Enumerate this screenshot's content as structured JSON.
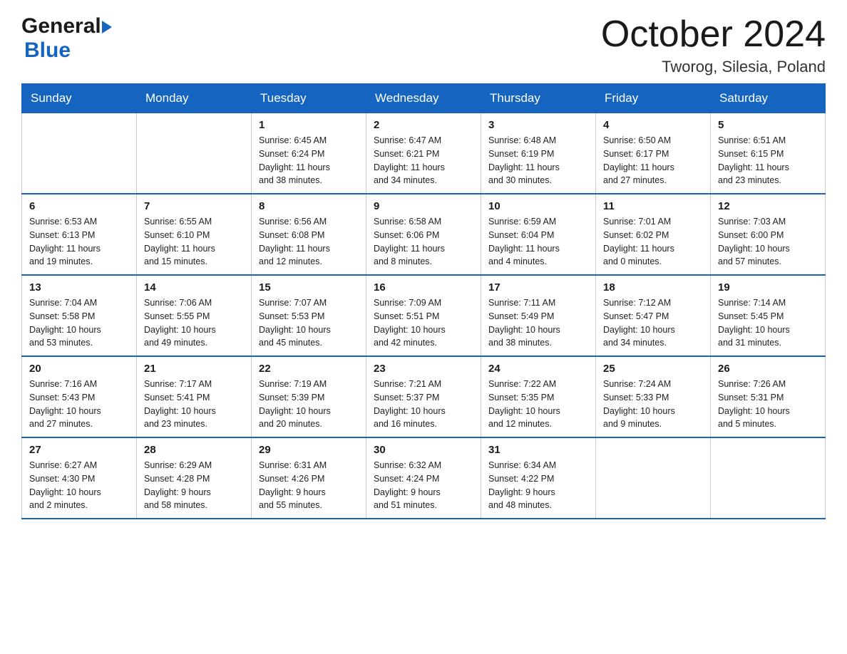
{
  "header": {
    "logo": {
      "line1": "General",
      "line2": "Blue"
    },
    "title": "October 2024",
    "location": "Tworog, Silesia, Poland"
  },
  "weekdays": [
    "Sunday",
    "Monday",
    "Tuesday",
    "Wednesday",
    "Thursday",
    "Friday",
    "Saturday"
  ],
  "weeks": [
    [
      {
        "day": "",
        "info": ""
      },
      {
        "day": "",
        "info": ""
      },
      {
        "day": "1",
        "info": "Sunrise: 6:45 AM\nSunset: 6:24 PM\nDaylight: 11 hours\nand 38 minutes."
      },
      {
        "day": "2",
        "info": "Sunrise: 6:47 AM\nSunset: 6:21 PM\nDaylight: 11 hours\nand 34 minutes."
      },
      {
        "day": "3",
        "info": "Sunrise: 6:48 AM\nSunset: 6:19 PM\nDaylight: 11 hours\nand 30 minutes."
      },
      {
        "day": "4",
        "info": "Sunrise: 6:50 AM\nSunset: 6:17 PM\nDaylight: 11 hours\nand 27 minutes."
      },
      {
        "day": "5",
        "info": "Sunrise: 6:51 AM\nSunset: 6:15 PM\nDaylight: 11 hours\nand 23 minutes."
      }
    ],
    [
      {
        "day": "6",
        "info": "Sunrise: 6:53 AM\nSunset: 6:13 PM\nDaylight: 11 hours\nand 19 minutes."
      },
      {
        "day": "7",
        "info": "Sunrise: 6:55 AM\nSunset: 6:10 PM\nDaylight: 11 hours\nand 15 minutes."
      },
      {
        "day": "8",
        "info": "Sunrise: 6:56 AM\nSunset: 6:08 PM\nDaylight: 11 hours\nand 12 minutes."
      },
      {
        "day": "9",
        "info": "Sunrise: 6:58 AM\nSunset: 6:06 PM\nDaylight: 11 hours\nand 8 minutes."
      },
      {
        "day": "10",
        "info": "Sunrise: 6:59 AM\nSunset: 6:04 PM\nDaylight: 11 hours\nand 4 minutes."
      },
      {
        "day": "11",
        "info": "Sunrise: 7:01 AM\nSunset: 6:02 PM\nDaylight: 11 hours\nand 0 minutes."
      },
      {
        "day": "12",
        "info": "Sunrise: 7:03 AM\nSunset: 6:00 PM\nDaylight: 10 hours\nand 57 minutes."
      }
    ],
    [
      {
        "day": "13",
        "info": "Sunrise: 7:04 AM\nSunset: 5:58 PM\nDaylight: 10 hours\nand 53 minutes."
      },
      {
        "day": "14",
        "info": "Sunrise: 7:06 AM\nSunset: 5:55 PM\nDaylight: 10 hours\nand 49 minutes."
      },
      {
        "day": "15",
        "info": "Sunrise: 7:07 AM\nSunset: 5:53 PM\nDaylight: 10 hours\nand 45 minutes."
      },
      {
        "day": "16",
        "info": "Sunrise: 7:09 AM\nSunset: 5:51 PM\nDaylight: 10 hours\nand 42 minutes."
      },
      {
        "day": "17",
        "info": "Sunrise: 7:11 AM\nSunset: 5:49 PM\nDaylight: 10 hours\nand 38 minutes."
      },
      {
        "day": "18",
        "info": "Sunrise: 7:12 AM\nSunset: 5:47 PM\nDaylight: 10 hours\nand 34 minutes."
      },
      {
        "day": "19",
        "info": "Sunrise: 7:14 AM\nSunset: 5:45 PM\nDaylight: 10 hours\nand 31 minutes."
      }
    ],
    [
      {
        "day": "20",
        "info": "Sunrise: 7:16 AM\nSunset: 5:43 PM\nDaylight: 10 hours\nand 27 minutes."
      },
      {
        "day": "21",
        "info": "Sunrise: 7:17 AM\nSunset: 5:41 PM\nDaylight: 10 hours\nand 23 minutes."
      },
      {
        "day": "22",
        "info": "Sunrise: 7:19 AM\nSunset: 5:39 PM\nDaylight: 10 hours\nand 20 minutes."
      },
      {
        "day": "23",
        "info": "Sunrise: 7:21 AM\nSunset: 5:37 PM\nDaylight: 10 hours\nand 16 minutes."
      },
      {
        "day": "24",
        "info": "Sunrise: 7:22 AM\nSunset: 5:35 PM\nDaylight: 10 hours\nand 12 minutes."
      },
      {
        "day": "25",
        "info": "Sunrise: 7:24 AM\nSunset: 5:33 PM\nDaylight: 10 hours\nand 9 minutes."
      },
      {
        "day": "26",
        "info": "Sunrise: 7:26 AM\nSunset: 5:31 PM\nDaylight: 10 hours\nand 5 minutes."
      }
    ],
    [
      {
        "day": "27",
        "info": "Sunrise: 6:27 AM\nSunset: 4:30 PM\nDaylight: 10 hours\nand 2 minutes."
      },
      {
        "day": "28",
        "info": "Sunrise: 6:29 AM\nSunset: 4:28 PM\nDaylight: 9 hours\nand 58 minutes."
      },
      {
        "day": "29",
        "info": "Sunrise: 6:31 AM\nSunset: 4:26 PM\nDaylight: 9 hours\nand 55 minutes."
      },
      {
        "day": "30",
        "info": "Sunrise: 6:32 AM\nSunset: 4:24 PM\nDaylight: 9 hours\nand 51 minutes."
      },
      {
        "day": "31",
        "info": "Sunrise: 6:34 AM\nSunset: 4:22 PM\nDaylight: 9 hours\nand 48 minutes."
      },
      {
        "day": "",
        "info": ""
      },
      {
        "day": "",
        "info": ""
      }
    ]
  ]
}
